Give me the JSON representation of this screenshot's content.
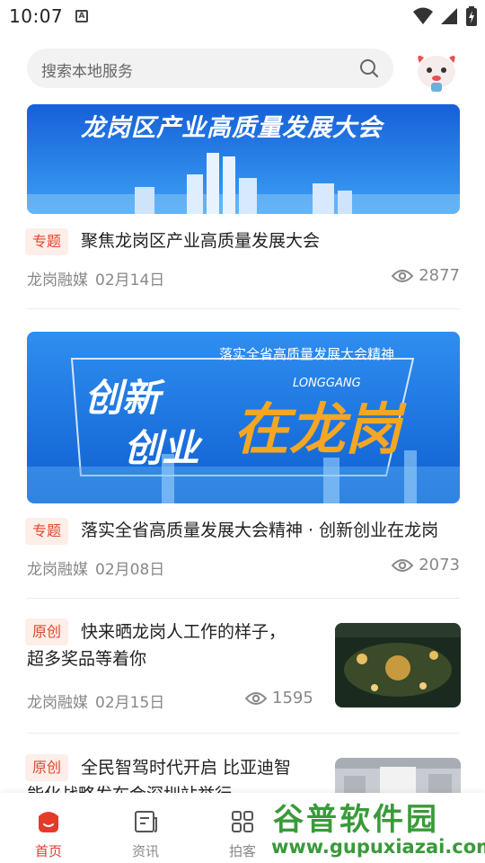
{
  "status": {
    "time": "10:07",
    "badge": "A"
  },
  "search": {
    "placeholder": "搜索本地服务"
  },
  "articles": [
    {
      "banner_text": "龙岗区产业高质量发展大会",
      "tag": "专题",
      "title": "聚焦龙岗区产业高质量发展大会",
      "source": "龙岗融媒",
      "date": "02月14日",
      "views": "2877"
    },
    {
      "banner_top": "落实全省高质量发展大会精神",
      "banner_en": "LONGGANG",
      "banner_left1": "创新",
      "banner_left2": "创业",
      "banner_right": "在龙岗",
      "tag": "专题",
      "title": "落实全省高质量发展大会精神 · 创新创业在龙岗",
      "source": "龙岗融媒",
      "date": "02月08日",
      "views": "2073"
    },
    {
      "tag": "原创",
      "title_line1": "快来晒龙岗人工作的样子，",
      "title_line2": "超多奖品等着你",
      "source": "龙岗融媒",
      "date": "02月15日",
      "views": "1595"
    },
    {
      "tag": "原创",
      "title_line1": "全民智驾时代开启 比亚迪智",
      "title_line2": "能化战略发布会深圳站举行"
    }
  ],
  "nav": [
    {
      "label": "首页",
      "icon": "home-icon",
      "active": true
    },
    {
      "label": "资讯",
      "icon": "news-icon",
      "active": false
    },
    {
      "label": "拍客",
      "icon": "grid-icon",
      "active": false
    }
  ],
  "watermark": {
    "title": "谷普软件园",
    "url": "www.gupuxiazai.com"
  },
  "colors": {
    "accent": "#e43a2a",
    "tag_bg": "#fdeeea",
    "tag_text": "#e0482a",
    "watermark": "#3a9a3a",
    "banner_blue": "#1e7be8"
  }
}
